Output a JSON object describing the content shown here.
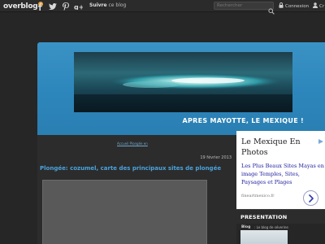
{
  "topbar": {
    "logo": "overblog",
    "social": [
      "facebook-icon",
      "twitter-icon",
      "pinterest-icon",
      "google-plus-icon"
    ],
    "follow_label": "Suivre",
    "follow_suffix": " ce blog",
    "search_placeholder": "Rechercher",
    "login_label": "Connexion",
    "create_label": "Cr"
  },
  "header": {
    "blog_title": "APRES MAYOTTE, LE MEXIQUE !"
  },
  "content": {
    "breadcrumb": "Accueil Plongée en",
    "date": "19 février 2013",
    "post_title": "Plongée: cozumel, carte des principaux sites de plongée"
  },
  "ad": {
    "title": "Le Mexique En Photos",
    "description": "Les Plus Beaux Sites Mayas en image Temples, Sites, Paysages et Plages",
    "url": "fineartmexico.fr"
  },
  "sidebar": {
    "title": "PRESENTATION",
    "tag": "Blog",
    "text": ": Le blog de séverine"
  },
  "colors": {
    "background": "#262626",
    "header_blue": "#2d86bb",
    "link_blue": "#4aa3dc"
  }
}
